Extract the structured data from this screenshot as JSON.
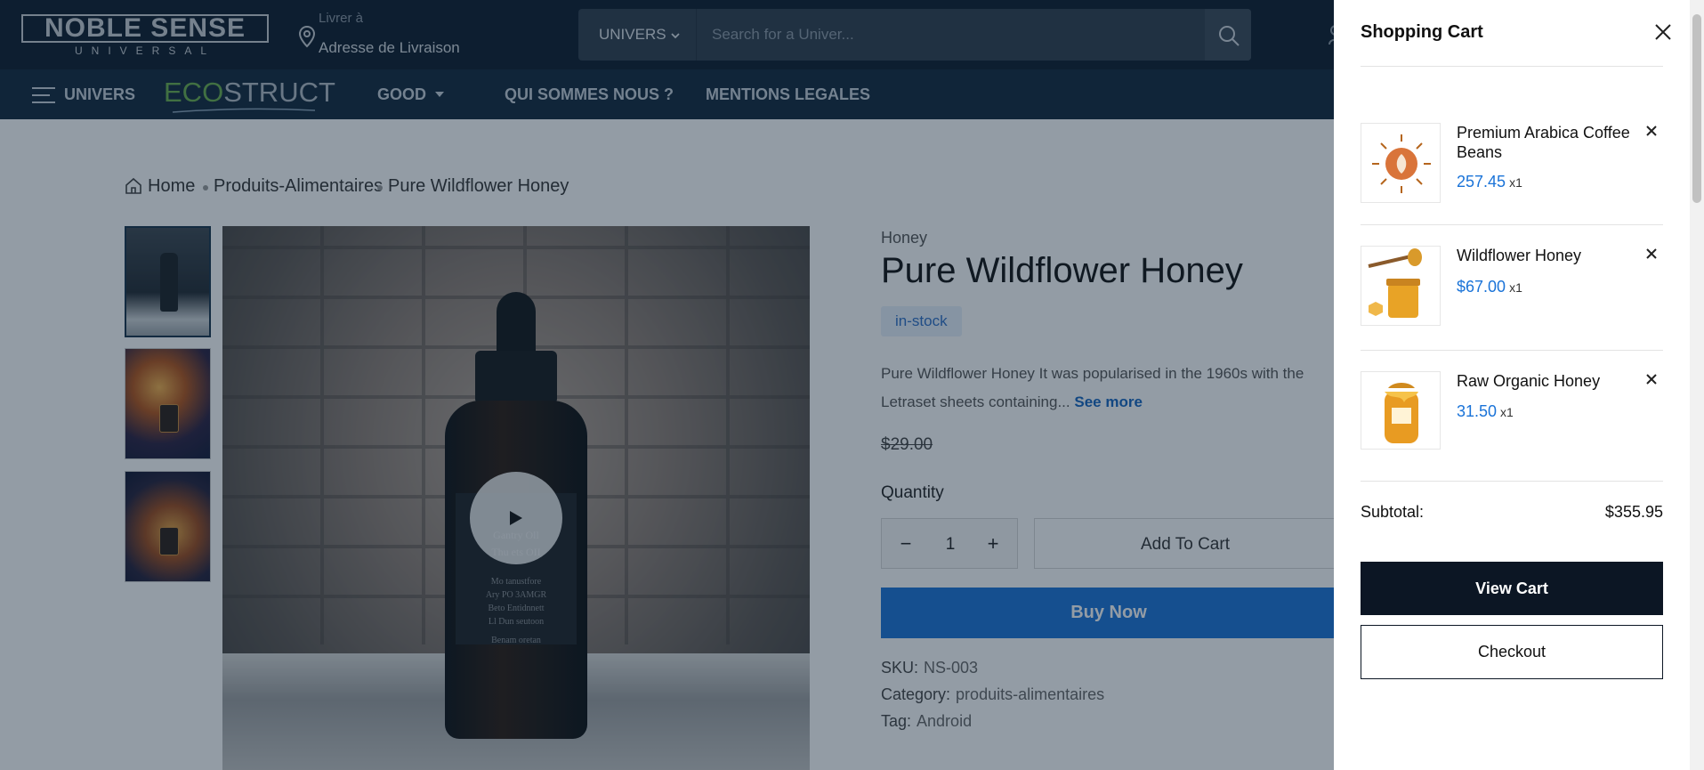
{
  "header": {
    "logo_main": "NOBLE SENSE",
    "logo_sub": "UNIVERSAL",
    "deliver_line1": "Livrer à",
    "deliver_line2": "Adresse de Livraison",
    "search_category": "UNIVERS",
    "search_placeholder": "Search for a Univer..."
  },
  "nav": {
    "univers": "UNIVERS",
    "ecostruct_eco": "ECO",
    "ecostruct_struct": "STRUCT",
    "good": "GOOD",
    "qui": "QUI SOMMES NOUS ?",
    "mentions": "MENTIONS LEGALES"
  },
  "breadcrumb": {
    "home": "Home",
    "category": "Produits-Alimentaires",
    "current": "Pure Wildflower Honey"
  },
  "product": {
    "category": "Honey",
    "title": "Pure Wildflower Honey",
    "stock": "in-stock",
    "desc_line1": "Pure Wildflower Honey It was popularised in the 1960s with the",
    "desc_line2": "Letraset sheets containing...",
    "see_more": "See more",
    "price": "$29.00",
    "quantity_label": "Quantity",
    "quantity": "1",
    "add_to_cart": "Add To Cart",
    "buy_now": "Buy Now",
    "sku_label": "SKU:",
    "sku": "NS-003",
    "category_label": "Category:",
    "category_value": "produits-alimentaires",
    "tag_label": "Tag:",
    "tag": "Android",
    "label_lines": [
      "Gantry Oll",
      "Thu ets OII",
      "Mo tanustfore",
      "Ary PO 3AMGR",
      "Beto Entidnnett",
      "Ll Dun seutoon",
      "Benam oretan"
    ]
  },
  "cart": {
    "title": "Shopping Cart",
    "items": [
      {
        "name_line1": "Premium Arabica Coffee",
        "name_line2": "Beans",
        "price": "257.45",
        "qty": "x1"
      },
      {
        "name_line1": "Wildflower Honey",
        "name_line2": "",
        "price": "$67.00",
        "qty": "x1"
      },
      {
        "name_line1": "Raw Organic Honey",
        "name_line2": "",
        "price": "31.50",
        "qty": "x1"
      }
    ],
    "subtotal_label": "Subtotal:",
    "subtotal_value": "$355.95",
    "view_cart": "View Cart",
    "checkout": "Checkout"
  },
  "colors": {
    "header_bg": "#0c1a2a",
    "nav_bg": "#11273b",
    "accent_blue": "#1a73d8",
    "eco_green": "#6ab04c",
    "dark_button": "#0c1624"
  }
}
